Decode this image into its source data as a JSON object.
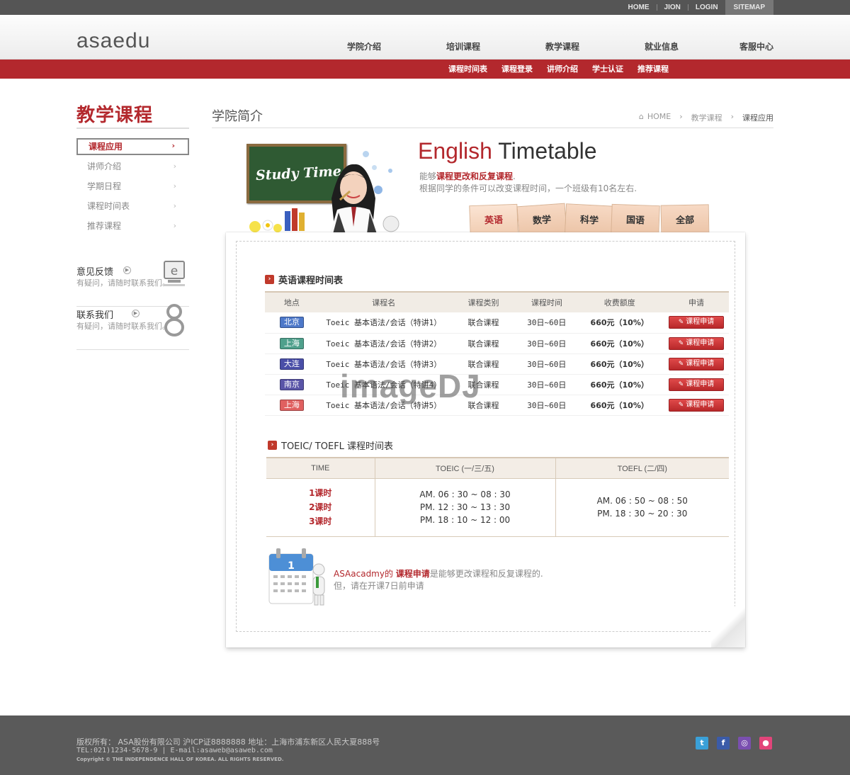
{
  "top_links": [
    "HOME",
    "JION",
    "LOGIN",
    "SITEMAP"
  ],
  "logo": "asaedu",
  "gnb": [
    "学院介绍",
    "培训课程",
    "教学课程",
    "就业信息",
    "客服中心"
  ],
  "subnav": [
    "课程时间表",
    "课程登录",
    "讲师介绍",
    "学士认证",
    "推荐课程"
  ],
  "sidebar": {
    "title": "教学课程",
    "items": [
      {
        "label": "课程应用",
        "active": true
      },
      {
        "label": "讲师介绍",
        "active": false
      },
      {
        "label": "学期日程",
        "active": false
      },
      {
        "label": "课程时间表",
        "active": false
      },
      {
        "label": "推荐课程",
        "active": false
      }
    ],
    "feedback": {
      "title": "意见反馈",
      "desc": "有疑问，请随时联系我们。",
      "icon": "monitor-e-icon"
    },
    "contact": {
      "title": "联系我们",
      "desc": "有疑问，请随时联系我们。",
      "icon": "person-icon"
    }
  },
  "content": {
    "title": "学院简介",
    "breadcrumb": [
      "HOME",
      "教学课程",
      "课程应用"
    ]
  },
  "hero": {
    "board_text": "Study Time",
    "title_red": "English",
    "title_rest": " Timetable",
    "desc1_prefix": "能够",
    "desc1_bold": "课程更改和反复课程",
    "desc1_suffix": ".",
    "desc2": "根据同学的条件可以改变课程时间，一个班级有10名左右."
  },
  "tabs": [
    "英语",
    "数学",
    "科学",
    "国语",
    "全部"
  ],
  "table1": {
    "title": "英语课程时间表",
    "headers": [
      "地点",
      "课程名",
      "课程类别",
      "课程时间",
      "收费额度",
      "申请"
    ],
    "rows": [
      {
        "loc": "北京",
        "loc_color": "#4d78c9",
        "name": "Toeic 基本语法/会话（特讲1）",
        "type": "联合课程",
        "time": "30日~60日",
        "fee": "660元（10%）",
        "btn": "课程申请"
      },
      {
        "loc": "上海",
        "loc_color": "#4fa08c",
        "name": "Toeic 基本语法/会话（特讲2）",
        "type": "联合课程",
        "time": "30日~60日",
        "fee": "660元（10%）",
        "btn": "课程申请"
      },
      {
        "loc": "大连",
        "loc_color": "#4a4fa8",
        "name": "Toeic 基本语法/会话（特讲3）",
        "type": "联合课程",
        "time": "30日~60日",
        "fee": "660元（10%）",
        "btn": "课程申请"
      },
      {
        "loc": "南京",
        "loc_color": "#5a55a8",
        "name": "Toeic 基本语法/会话（特讲4）",
        "type": "联合课程",
        "time": "30日~60日",
        "fee": "660元（10%）",
        "btn": "课程申请"
      },
      {
        "loc": "上海",
        "loc_color": "#e06060",
        "name": "Toeic 基本语法/会话（特讲5）",
        "type": "联合课程",
        "time": "30日~60日",
        "fee": "660元（10%）",
        "btn": "课程申请"
      }
    ]
  },
  "table2": {
    "title": "TOEIC/ TOEFL 课程时间表",
    "headers": [
      "TIME",
      "TOEIC (一/三/五)",
      "TOEFL (二/四)"
    ],
    "sessions": [
      "1课时",
      "2课时",
      "3课时"
    ],
    "toeic": [
      "AM. 06 : 30 ~ 08 : 30",
      "PM. 12 : 30 ~ 13 : 30",
      "PM. 18 : 10 ~ 12 : 00"
    ],
    "toefl": [
      "AM. 06 : 50 ~ 08 : 50",
      "PM. 18 : 30 ~ 20 : 30"
    ]
  },
  "note": {
    "line1_brand": "ASAacadmy的 ",
    "line1_bold": "课程申请",
    "line1_rest": "是能够更改课程和反复课程的.",
    "line2": "但，请在开课7日前申请"
  },
  "watermark": "imageDJ",
  "footer": {
    "line1": "版权所有： ASA股份有限公司 沪ICP证8888888 地址：上海市浦东新区人民大夏888号",
    "line2": "TEL:021)1234-5678-9 | E-mail:asaweb@asaweb.com",
    "line3": "Copyright © THE INDEPENDENCE HALL OF KOREA. ALL RIGHTS RESERVED.",
    "sns": [
      {
        "icon": "twitter-icon",
        "glyph": "t",
        "color": "#3aa0d8"
      },
      {
        "icon": "facebook-icon",
        "glyph": "f",
        "color": "#3b5ba8"
      },
      {
        "icon": "me2day-icon",
        "glyph": "◎",
        "color": "#7a4fb0"
      },
      {
        "icon": "blog-icon",
        "glyph": "●",
        "color": "#e2457a"
      }
    ]
  }
}
